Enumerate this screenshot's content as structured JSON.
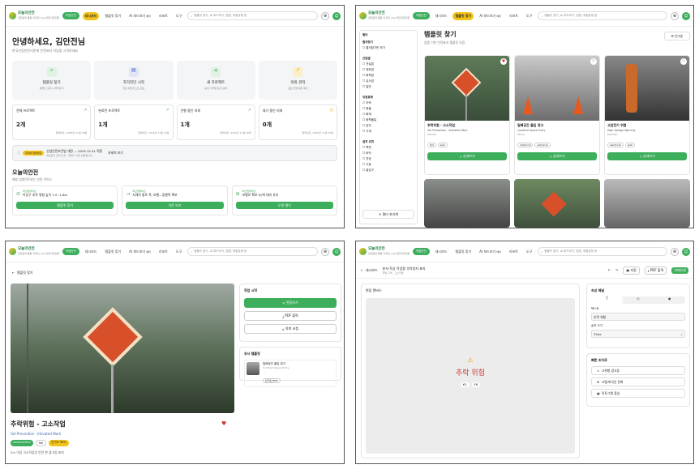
{
  "brand": {
    "name": "오늘의안전",
    "sub": "안전표지 통합 디자인 | by 안전디자인랩",
    "badge": "작업안전"
  },
  "nav": [
    "대시보드",
    "템플릿 찾기",
    "AI 피드보기",
    "리포트",
    "도구"
  ],
  "nav_beta": "베타",
  "search_placeholder": "템플릿 찾기, AI 피드보기, 법령, 위험유형 등",
  "dash": {
    "greeting": "안녕하세요, 김안전님",
    "subtitle": "한국산업안전기준에 안전표지 작업을 시작하세요",
    "quick": [
      {
        "title": "템플릿 찾기",
        "desc": "템플릿 조회 & 즐겨찾기"
      },
      {
        "title": "자가진단 시작",
        "desc": "현장 체크리스트 점검"
      },
      {
        "title": "새 프로젝트",
        "desc": "공정 구역별 표지 설계"
      },
      {
        "title": "의뢰 관리",
        "desc": "검토 진행 결과 확인"
      }
    ],
    "stats": [
      {
        "label": "전체 프로젝트",
        "value": "2개",
        "date": "업데이트: 2025년 11월 30일"
      },
      {
        "label": "완료된 프로젝트",
        "value": "1개",
        "date": "업데이트: 2025년 11월 30일"
      },
      {
        "label": "진행 중인 의뢰",
        "value": "1개",
        "date": "업데이트: 2025년 11월 30일"
      },
      {
        "label": "대기 중인 의뢰",
        "value": "0개",
        "date": "업데이트: 2025년 11월 30일"
      }
    ],
    "notice_tag": "주의의 업데이트",
    "notice_text": "산업안전보건법 개정 — 2025.12.01 적용",
    "notice_sub": "현장표지 관리 규칙 · 제재기 사항 반영됩니다.",
    "notice_link": "자세히 보기",
    "today_title": "오늘의안전",
    "today_sub": "매일 업데이트되는 안전 가이드",
    "today": [
      {
        "tag": "최신업데이트",
        "text": "이상구 추락 위험 높이 1.5~1.8m",
        "btn": "템플릿 찾기"
      },
      {
        "tag": "최신업데이트",
        "text": "지게차 통로 폭, 보행—동행폭 확보",
        "btn": "가운 보기"
      },
      {
        "tag": "최신업데이트",
        "text": "보행로 확보 뉴/벽 대비 유지",
        "btn": "도면 열기"
      }
    ]
  },
  "tpl": {
    "title": "템플릿 찾기",
    "subtitle": "업종 기반 안전표지 템플릿 모음",
    "sort": "인기순",
    "reset": "필터 초기화",
    "view": "상세보기",
    "filters": [
      {
        "head": "필터",
        "items": []
      },
      {
        "head": "즐겨찾기",
        "items": [
          "즐겨찾기만 보기"
        ]
      },
      {
        "head": "산업별",
        "items": [
          "전설업",
          "제조업",
          "화학업",
          "유사업",
          "일반"
        ]
      },
      {
        "head": "위험유형",
        "items": [
          "추락",
          "충돌",
          "화재",
          "화학물질",
          "감전",
          "기계"
        ]
      },
      {
        "head": "설치 위치",
        "items": [
          "벽면",
          "바닥",
          "천장",
          "기둥",
          "출입구"
        ]
      }
    ],
    "cards": [
      {
        "title": "추락위험 - 고소작업",
        "en": "Fall Prevention - Elevated Work",
        "code": "KR-FALL",
        "tags": [
          "fall",
          "wall"
        ]
      },
      {
        "title": "밀폐공간 출입 경고",
        "en": "Confined Space Entry",
        "code": "KR-CS",
        "tags": [
          "chemical",
          "entrance"
        ]
      },
      {
        "title": "고압전기 위험",
        "en": "High Voltage Warning",
        "code": "KR-ELEC",
        "tags": [
          "electrical",
          "wall"
        ]
      }
    ]
  },
  "detail": {
    "back": "템플릿 찾기",
    "title": "추락위험 - 고소작업",
    "en": "Fall Prevention - Elevated Work",
    "tags": [
      "construction",
      "fall"
    ],
    "rating": "인기도 98%",
    "desc": "2m 이상 고소작업장 안전 판 광고등 표지",
    "work_head": "작업 시작",
    "edit": "편집하기",
    "pdf": "PDF 출력",
    "share": "의뢰 요청",
    "related_head": "유사 템플릿",
    "rel_title": "밀폐공간 출입 경고",
    "rel_sub": "Confined Space Entry",
    "rel_tag": "인기도 85%"
  },
  "editor": {
    "back": "대시보드",
    "title": "분서 독상 작업용 추락방지 표지",
    "sub": "작업 구역 · 고소작업",
    "save": "저장",
    "pdf": "PDF 출력",
    "request": "의뢰요청",
    "canvas_label": "편집 캔버스",
    "sign_text": "추락 위험",
    "langs": [
      "KO",
      "EN"
    ],
    "prop_head": "속성 패널",
    "text_label": "텍스트",
    "text_value": "추락 위험",
    "font_label": "글자 크기",
    "font_value": "32px",
    "quick_head": "빠른 조치로",
    "quick": [
      "고위험 경고등",
      "고령/외국인 친화",
      "픽토그램 중심"
    ]
  }
}
